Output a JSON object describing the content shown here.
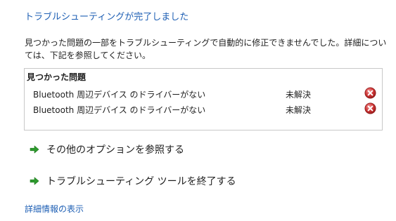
{
  "title": "トラブルシューティングが完了しました",
  "description": "見つかった問題の一部をトラブルシューティングで自動的に修正できませんでした。詳細については、下記を参照してください。",
  "problems": {
    "header": "見つかった問題",
    "items": [
      {
        "name": "Bluetooth 周辺デバイス のドライバーがない",
        "status": "未解決",
        "status_icon": "error-icon"
      },
      {
        "name": "Bluetooth 周辺デバイス のドライバーがない",
        "status": "未解決",
        "status_icon": "error-icon"
      }
    ]
  },
  "options": [
    {
      "label": "その他のオプションを参照する",
      "icon": "green-arrow-icon"
    },
    {
      "label": "トラブルシューティング ツールを終了する",
      "icon": "green-arrow-icon"
    }
  ],
  "details_link": "詳細情報の表示",
  "colors": {
    "link": "#1e5fb4",
    "arrow": "#2e9a2e",
    "error": "#c62828"
  }
}
